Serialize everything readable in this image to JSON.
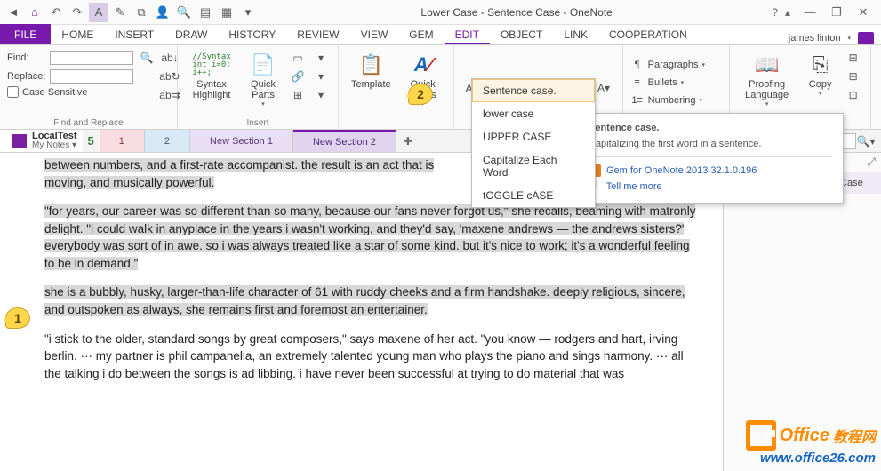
{
  "title": "Lower Case - Sentence Case - OneNote",
  "quick_access": [
    "back",
    "save",
    "undo",
    "redo",
    "touch",
    "pen",
    "dock",
    "zoom",
    "print",
    "form",
    "grid",
    "more"
  ],
  "window_controls": {
    "help": "?",
    "collapse": "▴",
    "min": "—",
    "max": "❐",
    "close": "✕"
  },
  "ribbon_tabs": [
    "HOME",
    "INSERT",
    "DRAW",
    "HISTORY",
    "REVIEW",
    "VIEW",
    "GEM",
    "EDIT",
    "OBJECT",
    "LINK",
    "COOPERATION"
  ],
  "active_tab": "EDIT",
  "file_tab": "FILE",
  "user": "james linton",
  "find": {
    "find_label": "Find:",
    "replace_label": "Replace:",
    "case_label": "Case Sensitive",
    "group_label": "Find and Replace"
  },
  "insert_group": {
    "syntax": "Syntax Highlight",
    "quick": "Quick Parts",
    "label": "Insert"
  },
  "template_group": {
    "template": "Template",
    "styles": "Quick Styles"
  },
  "case_menu": {
    "btn": "Aa",
    "items": [
      "Sentence case.",
      "lower case",
      "UPPER CASE",
      "Capitalize Each Word",
      "tOGGLE cASE"
    ]
  },
  "tooltip": {
    "title": "Sentence case.",
    "body": "Capitalizing the first word in a sentence.",
    "product": "Gem for OneNote 2013 32.1.0.196",
    "more": "Tell me more"
  },
  "paragraph": {
    "p": "Paragraphs",
    "b": "Bullets",
    "n": "Numbering"
  },
  "proofing": {
    "lang": "Proofing Language",
    "copy": "Copy"
  },
  "notebook": {
    "name": "LocalTest",
    "sub": "My Notes",
    "sync": "5"
  },
  "sections": [
    "1",
    "2",
    "New Section 1",
    "New Section 2"
  ],
  "page_list_item": "Lower Case - Sentence Case",
  "callouts": {
    "c1": "1",
    "c2": "2"
  },
  "body": {
    "p1a": "between numbers, and a first-rate accompanist. the result is an act that is",
    "p1b": "moving, and musically powerful.",
    "p2": "\"for years, our career was so different than so many, because our fans never forgot us,\" she recalls, beaming with matronly delight. \"i could walk in anyplace in the years i wasn't working, and they'd say, 'maxene andrews — the andrews sisters?' everybody was sort of in awe. so i was always treated like a star of some kind. but it's nice to work; it's a wonderful feeling to be in demand.\"",
    "p3": "she is a bubbly, husky, larger-than-life character of 61 with ruddy cheeks and a firm handshake. deeply religious, sincere, and outspoken as always, she remains first and foremost an entertainer.",
    "p4": "\"i stick to the older, standard songs by great composers,\" says maxene of her act. \"you know — rodgers and hart, irving berlin. ··· my partner is phil campanella, an extremely talented young man who plays the piano and sings harmony. ··· all the talking i do between the songs is ad libbing. i have never been successful at trying to do material that was"
  },
  "watermark": {
    "brand": "Office",
    "suffix": "教程网",
    "url": "www.office26.com"
  }
}
